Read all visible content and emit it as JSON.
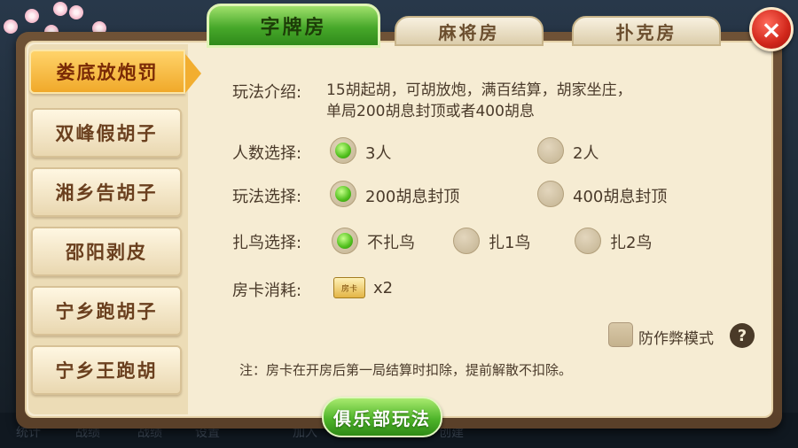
{
  "tabs": [
    {
      "label": "字牌房",
      "active": true
    },
    {
      "label": "麻将房",
      "active": false
    },
    {
      "label": "扑克房",
      "active": false
    }
  ],
  "close_icon": "×",
  "sidebar": {
    "items": [
      {
        "label": "娄底放炮罚",
        "active": true
      },
      {
        "label": "双峰假胡子",
        "active": false
      },
      {
        "label": "湘乡告胡子",
        "active": false
      },
      {
        "label": "邵阳剥皮",
        "active": false
      },
      {
        "label": "宁乡跑胡子",
        "active": false
      },
      {
        "label": "宁乡王跑胡",
        "active": false
      }
    ]
  },
  "rules": {
    "intro_label": "玩法介绍:",
    "intro_line1": "15胡起胡，可胡放炮，满百结算，胡家坐庄，",
    "intro_line2": "单局200胡息封顶或者400胡息",
    "players": {
      "label": "人数选择:",
      "options": [
        {
          "label": "3人",
          "selected": true
        },
        {
          "label": "2人",
          "selected": false
        }
      ]
    },
    "mode": {
      "label": "玩法选择:",
      "options": [
        {
          "label": "200胡息封顶",
          "selected": true
        },
        {
          "label": "400胡息封顶",
          "selected": false
        }
      ]
    },
    "birds": {
      "label": "扎鸟选择:",
      "options": [
        {
          "label": "不扎鸟",
          "selected": true
        },
        {
          "label": "扎1鸟",
          "selected": false
        },
        {
          "label": "扎2鸟",
          "selected": false
        }
      ]
    },
    "cost": {
      "label": "房卡消耗:",
      "card_icon_text": "房卡",
      "amount": "x2"
    },
    "anticheat": {
      "label": "防作弊模式",
      "checked": false,
      "help_icon": "?"
    },
    "note": "注：房卡在开房后第一局结算时扣除，提前解散不扣除。"
  },
  "club_button": "俱乐部玩法",
  "background_bar": [
    "统计",
    "战绩",
    "战绩",
    "设置",
    "加入",
    "创建"
  ],
  "colors": {
    "accent_green": "#4fb52a",
    "panel": "#f6ecd3",
    "tab_active": "#47a82a",
    "close_red": "#d0261a"
  }
}
